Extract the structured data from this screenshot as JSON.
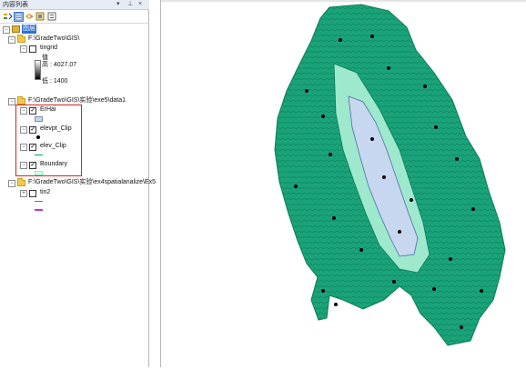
{
  "toc": {
    "title": "内容列表",
    "pin_glyph": "▾ ‑ ×",
    "root": "图层",
    "groups": [
      {
        "path": "F:\\GradeTwo\\GIS\\",
        "layers": [
          {
            "name": "tingrid",
            "checked": false,
            "legend": {
              "title": "值",
              "high": "高 : 4027.07",
              "low": "低 : 1400"
            }
          }
        ]
      },
      {
        "path": "F:\\GradeTwo\\GIS\\实验\\exe5\\data1",
        "layers": [
          {
            "name": "ErHai",
            "checked": true
          },
          {
            "name": "elevpt_Clip",
            "checked": true
          },
          {
            "name": "elev_Clip",
            "checked": true
          },
          {
            "name": "Boundary",
            "checked": true
          }
        ]
      },
      {
        "path": "F:\\GradeTwo\\GIS\\实验\\ex4spatialanalize\\Ex5",
        "layers": [
          {
            "name": "tin2",
            "checked": false
          }
        ]
      }
    ],
    "toolbar_icons": [
      "list-by-drawing-order-icon",
      "list-by-source-icon",
      "list-by-visibility-icon",
      "list-by-selection-icon",
      "options-icon"
    ]
  },
  "colors": {
    "contour": "#0f9a6e",
    "fill_high": "#1aa37a",
    "fill_low": "#9ee8cd",
    "lake": "#c7d7ef",
    "highlight": "#e02020"
  }
}
